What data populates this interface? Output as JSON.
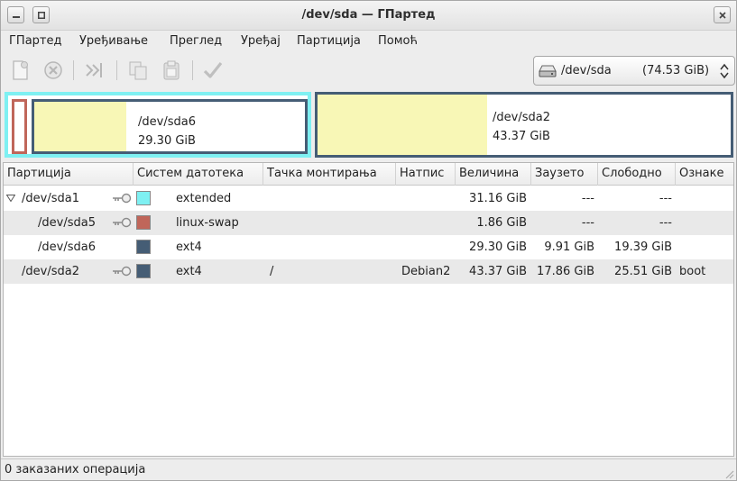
{
  "window": {
    "title": "/dev/sda — ГПартед",
    "controls": [
      "minimize",
      "maximize",
      "close"
    ]
  },
  "menu": [
    "ГПартед",
    "Уређивање",
    "Преглед",
    "Уређај",
    "Партиција",
    "Помоћ"
  ],
  "toolbar": {
    "icons": [
      "new-icon",
      "delete-icon",
      "resize-move-icon",
      "copy-icon",
      "paste-icon",
      "apply-icon"
    ]
  },
  "device_selector": {
    "icon": "harddisk-icon",
    "device": "/dev/sda",
    "size": "(74.53 GiB)"
  },
  "disk_map": {
    "sda6": {
      "name": "/dev/sda6",
      "size": "29.30 GiB",
      "used_fraction": 0.34
    },
    "sda2": {
      "name": "/dev/sda2",
      "size": "43.37 GiB",
      "used_fraction": 0.41
    }
  },
  "table": {
    "headers": [
      "Партиција",
      "Систем датотека",
      "Тачка монтирања",
      "Натпис",
      "Величина",
      "Заузето",
      "Слободно",
      "Ознаке"
    ],
    "rows": [
      {
        "partition": "/dev/sda1",
        "color": "#7ef0f2",
        "filesystem": "extended",
        "mount": "",
        "label": "",
        "size": "31.16 GiB",
        "used": "---",
        "free": "---",
        "flags": ""
      },
      {
        "partition": "/dev/sda5",
        "color": "#c0665a",
        "filesystem": "linux-swap",
        "mount": "",
        "label": "",
        "size": "1.86 GiB",
        "used": "---",
        "free": "---",
        "flags": ""
      },
      {
        "partition": "/dev/sda6",
        "color": "#455d75",
        "filesystem": "ext4",
        "mount": "",
        "label": "",
        "size": "29.30 GiB",
        "used": "9.91 GiB",
        "free": "19.39 GiB",
        "flags": ""
      },
      {
        "partition": "/dev/sda2",
        "color": "#455d75",
        "filesystem": "ext4",
        "mount": "/",
        "label": "Debian2",
        "size": "43.37 GiB",
        "used": "17.86 GiB",
        "free": "25.51 GiB",
        "flags": "boot"
      }
    ]
  },
  "status": "0 заказаних операција"
}
